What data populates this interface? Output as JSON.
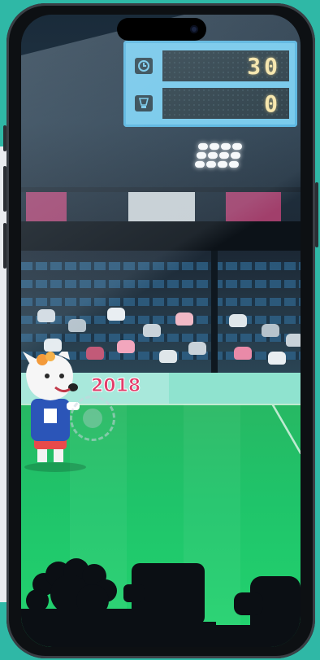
{
  "scoreboard": {
    "time_icon": "clock-icon",
    "time_value": "30",
    "score_icon": "shuttlecock-icon",
    "score_value": "0"
  },
  "stadium": {
    "wall_text": "2018"
  },
  "colors": {
    "background": "#2fb8a6",
    "scoreboard": "#6ec8ec",
    "digits": "#ffe9a3",
    "field": "#23d46f",
    "wall_text": "#e23c6a"
  }
}
